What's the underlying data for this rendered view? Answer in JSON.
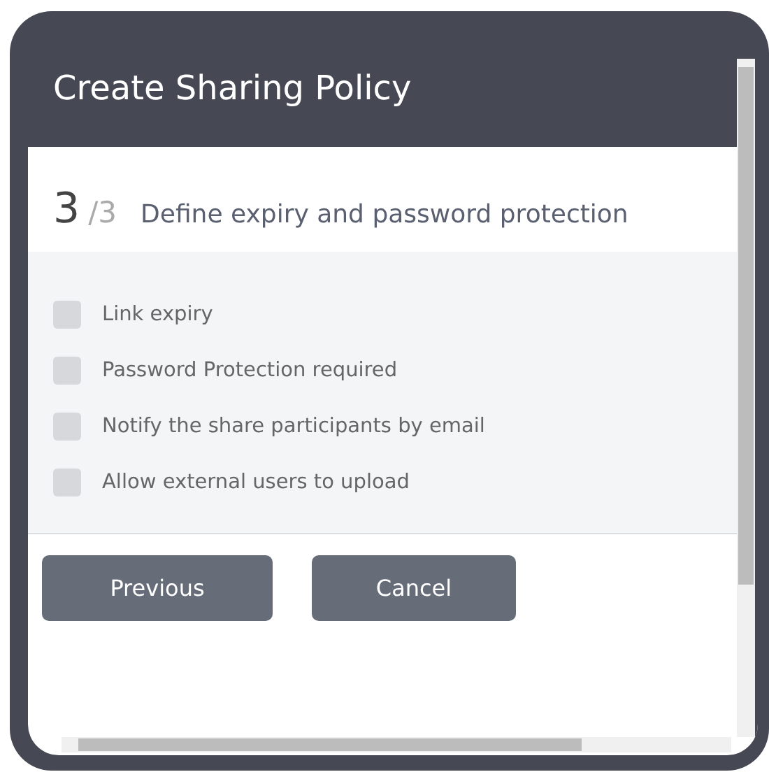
{
  "dialog": {
    "title": "Create Sharing Policy"
  },
  "step": {
    "current": "3",
    "total": "/3",
    "description": "Define expiry and password protection"
  },
  "options": [
    {
      "label": "Link expiry",
      "checked": false
    },
    {
      "label": "Password Protection required",
      "checked": false
    },
    {
      "label": "Notify the share participants by email",
      "checked": false
    },
    {
      "label": "Allow external users to upload",
      "checked": false
    }
  ],
  "buttons": [
    {
      "label": "Previous"
    },
    {
      "label": "Cancel"
    }
  ]
}
